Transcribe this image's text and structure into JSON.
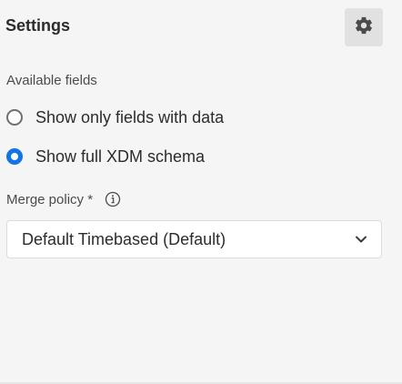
{
  "header": {
    "title": "Settings",
    "settings_icon": "gear-icon"
  },
  "available_fields": {
    "label": "Available fields",
    "options": [
      {
        "label": "Show only fields with data",
        "selected": false
      },
      {
        "label": "Show full XDM schema",
        "selected": true
      }
    ]
  },
  "merge_policy": {
    "label": "Merge policy *",
    "info_icon": "info-icon",
    "selected_value": "Default Timebased (Default)",
    "dropdown_icon": "chevron-down-icon"
  },
  "colors": {
    "accent": "#1473e6",
    "background": "#f5f5f5"
  }
}
